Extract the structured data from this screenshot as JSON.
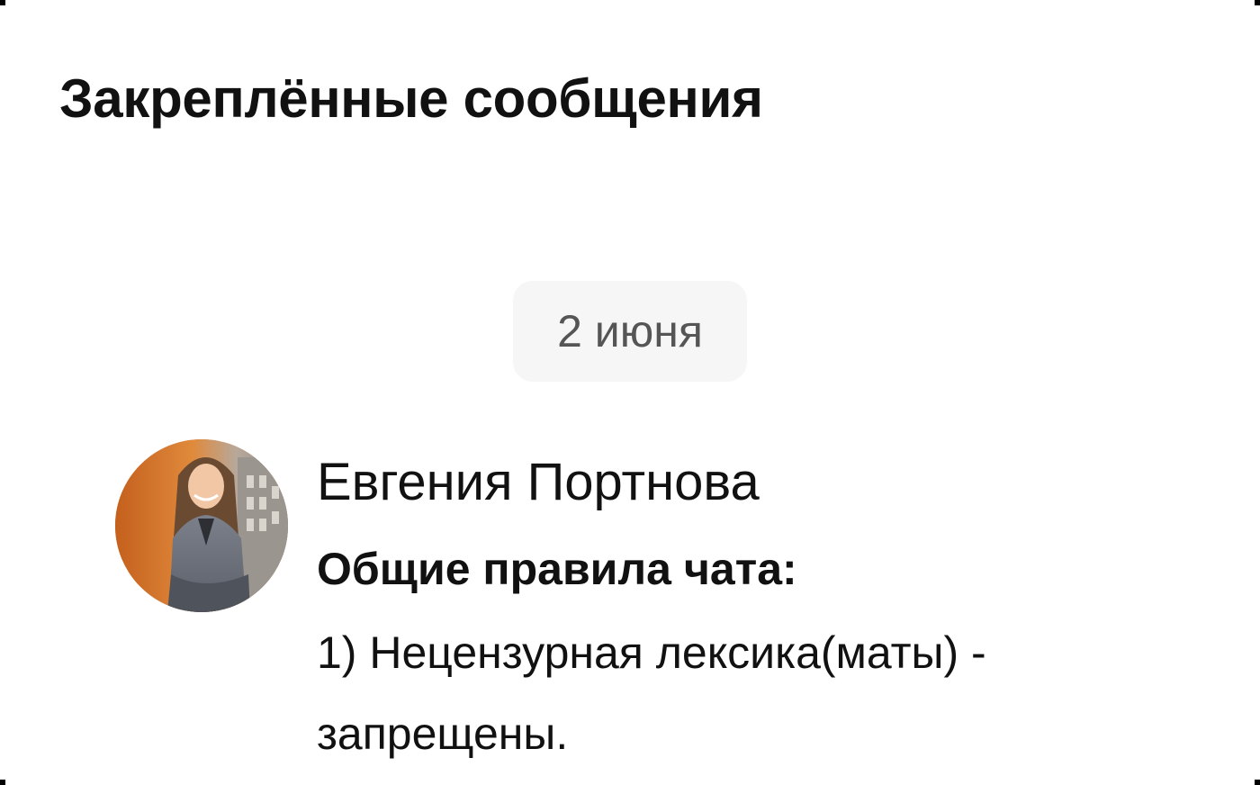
{
  "panel": {
    "title": "Закреплённые сообщения"
  },
  "feed": {
    "date_separator": "2 июня"
  },
  "message": {
    "author": "Евгения Портнова",
    "avatar_icon": "user-photo-avatar",
    "heading": "Общие правила чата:",
    "text": "1) Нецензурная лексика(маты) - запрещены."
  },
  "colors": {
    "background": "#ffffff",
    "date_chip_bg": "#f6f6f6",
    "date_chip_text": "#555555",
    "primary_text": "#111111",
    "avatar_bg": "#c96a25"
  }
}
